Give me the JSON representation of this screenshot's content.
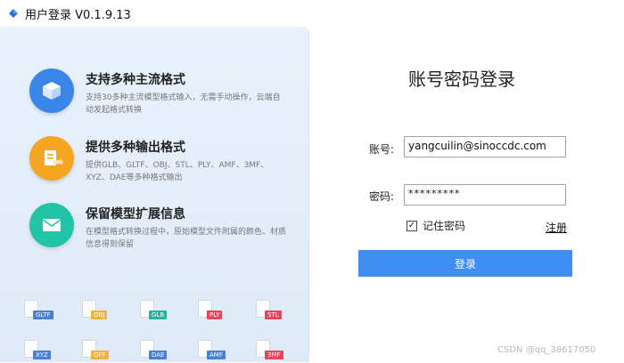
{
  "window": {
    "title": "用户登录 V0.1.9.13",
    "icon": "app-logo-icon"
  },
  "features": [
    {
      "icon": "cube-icon",
      "color": "#3a86e8",
      "title": "支持多种主流格式",
      "desc": "支持30多种主流模型格式输入，无需手动操作，云端自动发起格式转换"
    },
    {
      "icon": "export-doc-icon",
      "color": "#f5a524",
      "title": "提供多种输出格式",
      "desc": "提供GLB、GLTF、OBJ、STL、PLY、AMF、3MF、XYZ、DAE等多种格式输出"
    },
    {
      "icon": "envelope-icon",
      "color": "#22c3a6",
      "title": "保留模型扩展信息",
      "desc": "在模型格式转换过程中，原始模型文件附属的颜色、材质信息得到保留"
    }
  ],
  "formats": [
    {
      "label": "GLTF",
      "color": "#4a7fd6"
    },
    {
      "label": "OBJ",
      "color": "#f2b23b"
    },
    {
      "label": "GLB",
      "color": "#20b59a"
    },
    {
      "label": "PLY",
      "color": "#e8455a"
    },
    {
      "label": "STL",
      "color": "#e8455a"
    },
    {
      "label": "XYZ",
      "color": "#4a7fd6"
    },
    {
      "label": "OFF",
      "color": "#f2b23b"
    },
    {
      "label": "DAE",
      "color": "#4a7fd6"
    },
    {
      "label": "AMF",
      "color": "#4a7fd6"
    },
    {
      "label": "3MF",
      "color": "#e8455a"
    }
  ],
  "login": {
    "title": "账号密码登录",
    "account_label": "账号:",
    "account_value": "yangcuilin@sinoccdc.com",
    "password_label": "密码:",
    "password_value": "*********",
    "remember_label": "记住密码",
    "remember_checked": "✓",
    "register_label": "注册",
    "submit_label": "登录",
    "accent": "#3d8ef0"
  },
  "watermark": "CSDN @qq_38617050"
}
